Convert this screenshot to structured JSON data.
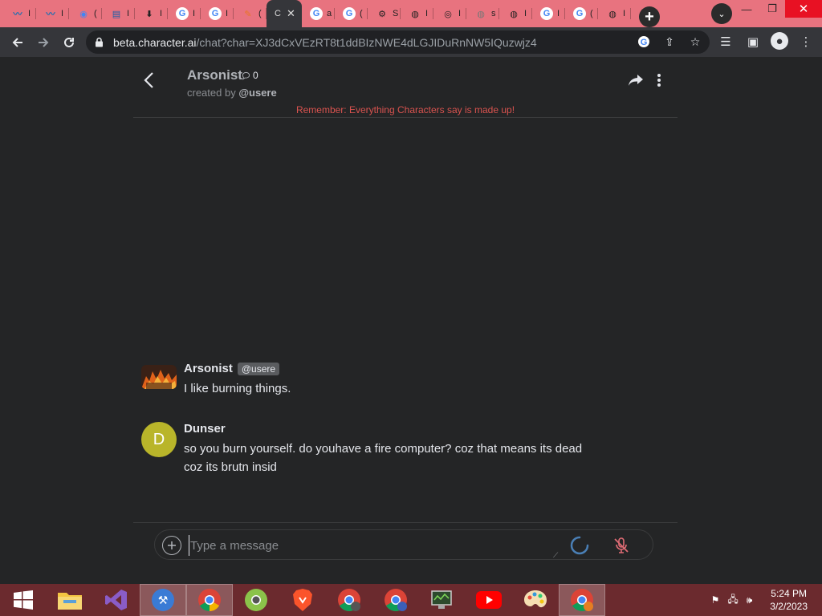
{
  "browser": {
    "tabs": [
      {
        "icon": "meetup-icon",
        "color": "#1f6fb2",
        "glyph": "〰",
        "title": "I"
      },
      {
        "icon": "meetup-icon",
        "color": "#1f6fb2",
        "glyph": "〰",
        "title": "I"
      },
      {
        "icon": "chrome-icon",
        "color": "#4285f4",
        "glyph": "◉",
        "title": "("
      },
      {
        "icon": "news-icon",
        "color": "#1a5ea8",
        "glyph": "▤",
        "title": "I"
      },
      {
        "icon": "download-icon",
        "color": "#222222",
        "glyph": "⬇",
        "title": "I"
      },
      {
        "icon": "google-icon",
        "color": "#ffffff",
        "glyph": "G",
        "title": "I"
      },
      {
        "icon": "google-icon",
        "color": "#ffffff",
        "glyph": "G",
        "title": "I"
      },
      {
        "icon": "pencil-icon",
        "color": "#e87722",
        "glyph": "✎",
        "title": "("
      },
      {
        "icon": "character-ai-icon",
        "color": "#35363a",
        "glyph": "",
        "title": "C",
        "active": true
      },
      {
        "icon": "google-icon",
        "color": "#ffffff",
        "glyph": "G",
        "title": "a"
      },
      {
        "icon": "google-icon",
        "color": "#ffffff",
        "glyph": "G",
        "title": "("
      },
      {
        "icon": "settings-icon",
        "color": "#222222",
        "glyph": "⚙",
        "title": "S"
      },
      {
        "icon": "globe-icon",
        "color": "#222222",
        "glyph": "◍",
        "title": "I"
      },
      {
        "icon": "chrome-icon",
        "color": "#222222",
        "glyph": "◎",
        "title": "I"
      },
      {
        "icon": "globe-icon",
        "color": "#777777",
        "glyph": "◍",
        "title": "s"
      },
      {
        "icon": "globe-icon",
        "color": "#222222",
        "glyph": "◍",
        "title": "I"
      },
      {
        "icon": "google-icon",
        "color": "#ffffff",
        "glyph": "G",
        "title": "I"
      },
      {
        "icon": "google-icon",
        "color": "#ffffff",
        "glyph": "G",
        "title": "("
      },
      {
        "icon": "globe-icon",
        "color": "#222222",
        "glyph": "◍",
        "title": "I"
      }
    ],
    "url_host": "beta.character.ai",
    "url_path": "/chat?char=XJ3dCxVEzRT8t1ddBIzNWE4dLGJIDuRnNW5IQuzwjz4"
  },
  "chat": {
    "character_name": "Arsonist",
    "chat_count": "0",
    "created_by_prefix": "created by ",
    "creator": "@usere",
    "disclaimer": "Remember: Everything Characters say is made up!",
    "messages": [
      {
        "author": "Arsonist",
        "handle": "@usere",
        "text": "I like burning things."
      },
      {
        "author": "Dunser",
        "avatar_letter": "D",
        "text": "so you burn yourself. do youhave a fire computer? coz that means its dead coz its brutn insid"
      }
    ],
    "input_placeholder": "Type a message"
  },
  "taskbar": {
    "time": "5:24 PM",
    "date": "3/2/2023",
    "accent": "#6b2a2e"
  }
}
